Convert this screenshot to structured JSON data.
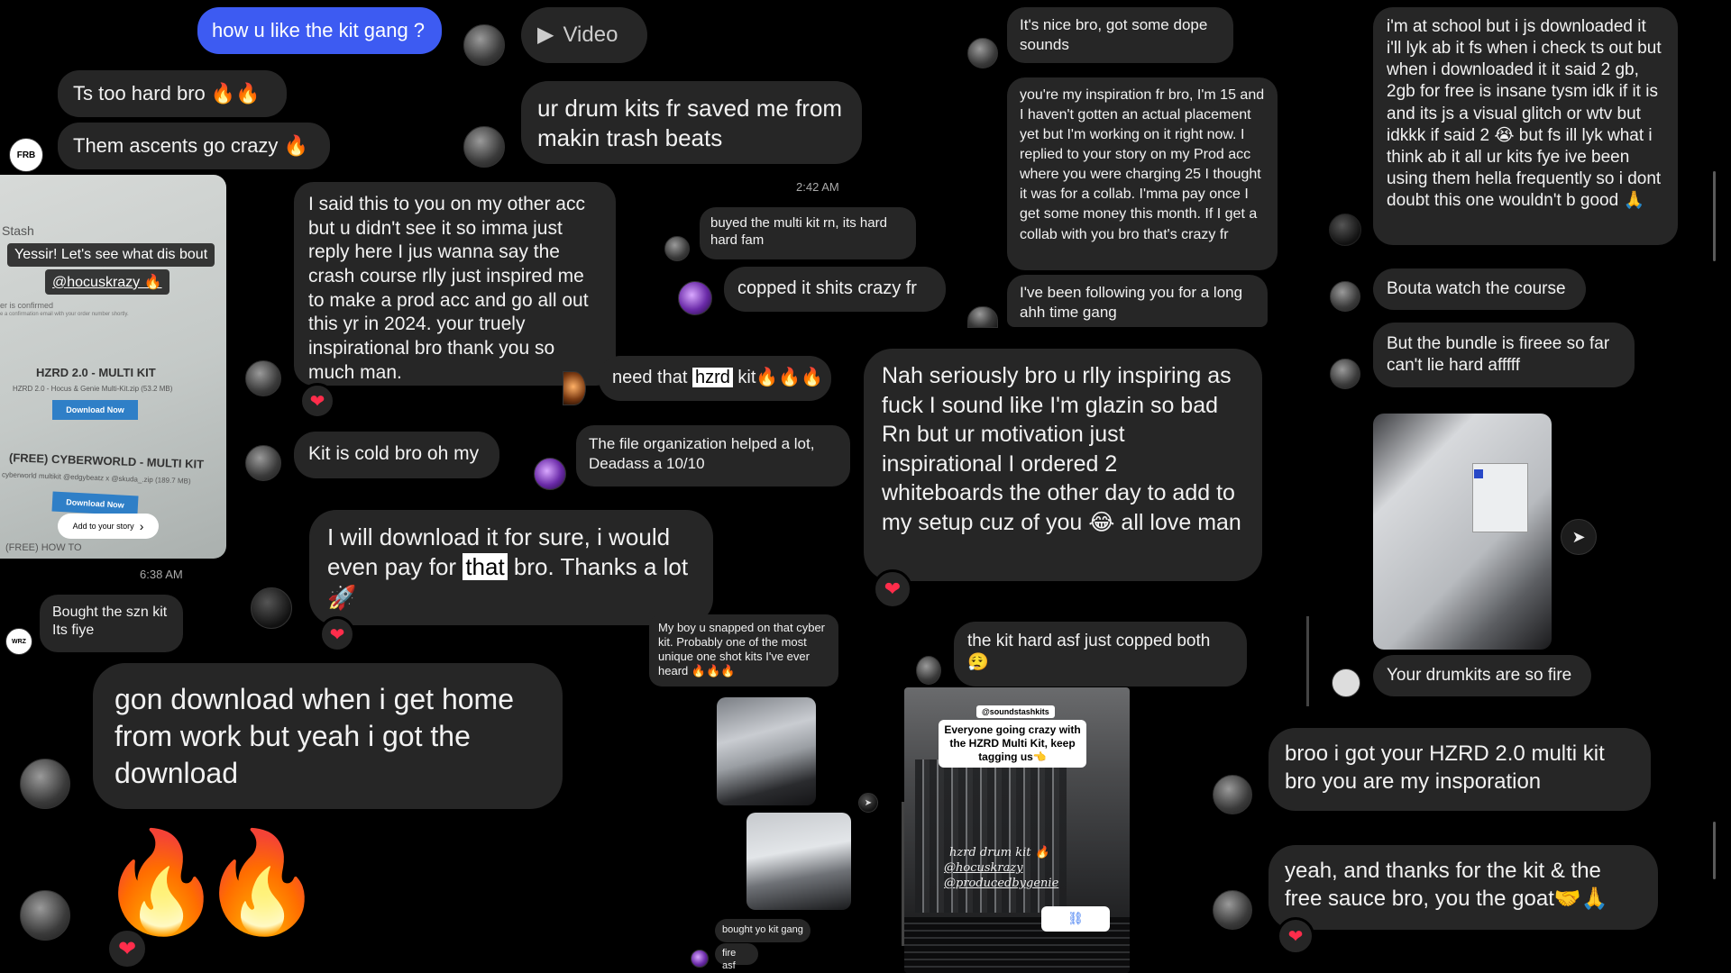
{
  "col1": {
    "msg_blue": "how u like the kit gang ?",
    "msg_too_hard": "Ts too hard bro 🔥🔥",
    "msg_ascents": "Them ascents go crazy 🔥",
    "story": {
      "stash_label": "Stash",
      "caption": "Yessir! Let's see what dis bout",
      "mention": "@hocuskrazy 🔥",
      "confirmed": "er is confirmed",
      "confirm_email": "e a confirmation email with your order number shortly.",
      "product1_title": "HZRD 2.0 - MULTI KIT",
      "product1_file": "HZRD 2.0 - Hocus & Genie Multi-Kit.zip (53.2 MB)",
      "download_btn": "Download Now",
      "product2_title": "(FREE) CYBERWORLD - MULTI KIT",
      "product2_file": "cyberworld multikit @edgybeatz x @skuda_.zip (189.7 MB)",
      "download_btn2": "Download Now",
      "add_story": "Add to your story",
      "footer_text": "(FREE) HOW TO"
    },
    "time_638": "6:38 AM",
    "msg_szn": "Bought the szn kit\nIts fiye",
    "msg_gon_download": "gon download when i get home from work but yeah i got the download",
    "fire_emoji": "🔥"
  },
  "col2": {
    "video_label": "Video",
    "msg_drum_kits": "ur drum kits fr saved me from makin trash beats",
    "msg_said_this": "I said this to you on my other acc but u didn't see it so imma just reply here I jus wanna say the crash course rlly just inspired me to make a prod acc and go all out this yr in 2024. your truely inspirational bro thank you so much man.",
    "msg_kit_cold": "Kit is cold bro oh my",
    "msg_download_pay_pre": "I will download it for sure, i would even pay for ",
    "msg_download_pay_hl": "that",
    "msg_download_pay_post": " bro. Thanks a lot 🚀"
  },
  "col3": {
    "time_242": "2:42 AM",
    "msg_buyed": "buyed the multi kit rn, its hard hard fam",
    "msg_copped": "copped it shits crazy fr",
    "msg_need_pre": "need that ",
    "msg_need_hl": "hzrd",
    "msg_need_post": " kit🔥🔥🔥",
    "msg_file_org": "The file organization helped a lot, Deadass a 10/10",
    "msg_snapped": "My boy u snapped on that cyber kit. Probably one of the most unique one shot kits I've ever heard 🔥🔥🔥",
    "msg_bought_yo": "bought yo kit gang",
    "msg_fire_asf": "fire asf"
  },
  "col4": {
    "msg_nice": "It's nice bro, got some dope sounds",
    "msg_inspiration": "you're my inspiration fr bro, I'm 15 and I haven't gotten an actual placement yet but I'm working on it right now. I replied to your story on my Prod acc where you were charging 25 I thought it was for a collab. I'mma pay once I get some money this month. If I get a collab with you bro that's crazy fr",
    "msg_following": "I've been following you for a long ahh time gang",
    "msg_nah": "Nah seriously bro u rlly inspiring as fuck I sound like I'm glazin so bad Rn but ur motivation just inspirational I ordered 2 whiteboards the other day to add to my setup cuz of you 😂 all love man",
    "msg_kit_hard": "the kit hard asf just copped both 😮‍💨",
    "story2": {
      "handle": "@soundstashkits",
      "headline": "Everyone going crazy with the HZRD Multi Kit, keep tagging us👈",
      "line1": "hzrd drum kit 🔥",
      "line2": "@hocuskrazy",
      "line3": "@producedbygenie"
    }
  },
  "col5": {
    "msg_school": "i'm at school but i js downloaded it i'll lyk ab it fs when i check ts out but when i downloaded it it said 2 gb, 2gb for free is insane tysm idk if it is and its js a visual glitch or wtv but idkkk if said 2 😭 but fs ill lyk what i think ab it all ur kits fye ive been using them hella frequently so i dont doubt this one wouldn't b good 🙏",
    "msg_bouta": "Bouta watch the course",
    "msg_bundle": "But the bundle is fireee so far can't lie hard afffff",
    "msg_drumkits_fire": "Your drumkits are so fire",
    "msg_broo": "broo i got your HZRD 2.0 multi kit bro you are my insporation",
    "msg_yeah": "yeah, and thanks for the kit & the free sauce bro, you the goat🤝🙏"
  },
  "icons": {
    "heart": "❤",
    "play": "▶",
    "send": "➤",
    "chevron": "›"
  },
  "colors": {
    "background": "#000000",
    "bubble": "#262626",
    "blue_bubble": "#3d5bf2",
    "heart": "#ff2d4b"
  }
}
